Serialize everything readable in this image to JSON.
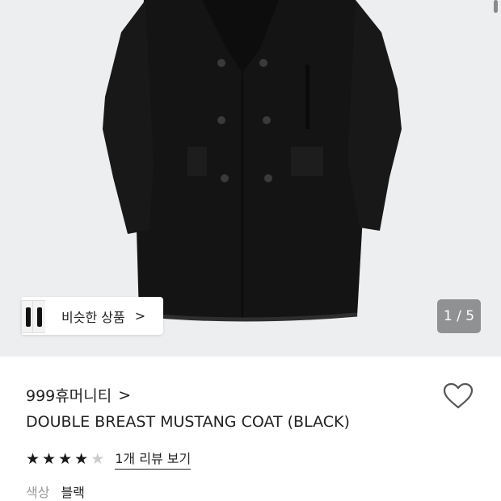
{
  "gallery": {
    "current": 1,
    "total": 5,
    "counter_text": "1 / 5",
    "similar_button_label": "비슷한 상품",
    "similar_button_arrow": ">"
  },
  "product": {
    "brand": "999휴머니티",
    "brand_arrow": ">",
    "title": "DOUBLE BREAST MUSTANG COAT (BLACK)",
    "rating_value": 4,
    "rating_max": 5,
    "review_link": "1개 리뷰 보기",
    "color_label": "색상",
    "color_value": "블랙"
  },
  "colors": {
    "background_hero": "#eceef0",
    "coat": "#141414",
    "counter_badge": "#8f9193",
    "star_active": "#1a1a1a",
    "star_inactive": "#cccccc"
  },
  "icons": {
    "wishlist": "heart-outline-icon",
    "similar_arrow": "chevron-right-icon"
  }
}
